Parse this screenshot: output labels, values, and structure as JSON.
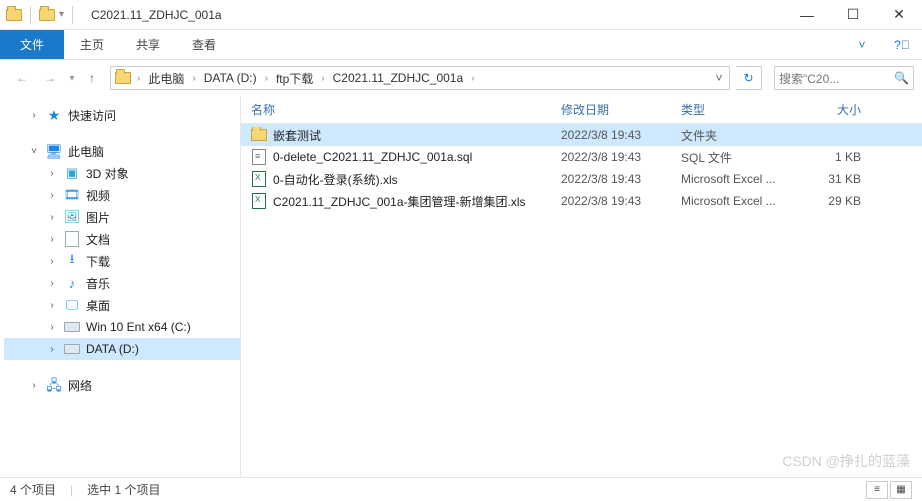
{
  "window": {
    "title": "C2021.11_ZDHJC_001a"
  },
  "ribbon": {
    "file": "文件",
    "home": "主页",
    "share": "共享",
    "view": "查看"
  },
  "breadcrumbs": {
    "items": [
      "此电脑",
      "DATA (D:)",
      "ftp下载",
      "C2021.11_ZDHJC_001a"
    ]
  },
  "search": {
    "placeholder": "搜索\"C20..."
  },
  "tree": {
    "quick_access": "快速访问",
    "this_pc": "此电脑",
    "objects_3d": "3D 对象",
    "videos": "视频",
    "pictures": "图片",
    "documents": "文档",
    "downloads": "下载",
    "music": "音乐",
    "desktop": "桌面",
    "drive_c": "Win 10 Ent x64 (C:)",
    "drive_d": "DATA (D:)",
    "network": "网络"
  },
  "columns": {
    "name": "名称",
    "date": "修改日期",
    "type": "类型",
    "size": "大小"
  },
  "files": {
    "rows": [
      {
        "name": "嵌套测试",
        "date": "2022/3/8 19:43",
        "type": "文件夹",
        "size": "",
        "icon": "folder",
        "selected": true
      },
      {
        "name": "0-delete_C2021.11_ZDHJC_001a.sql",
        "date": "2022/3/8 19:43",
        "type": "SQL 文件",
        "size": "1 KB",
        "icon": "sql",
        "selected": false
      },
      {
        "name": "0-自动化-登录(系统).xls",
        "date": "2022/3/8 19:43",
        "type": "Microsoft Excel ...",
        "size": "31 KB",
        "icon": "excel",
        "selected": false
      },
      {
        "name": "C2021.11_ZDHJC_001a-集团管理-新增集团.xls",
        "date": "2022/3/8 19:43",
        "type": "Microsoft Excel ...",
        "size": "29 KB",
        "icon": "excel",
        "selected": false
      }
    ]
  },
  "status": {
    "count": "4 个项目",
    "selection": "选中 1 个项目"
  },
  "watermark": "CSDN @挣扎的蓝藻"
}
